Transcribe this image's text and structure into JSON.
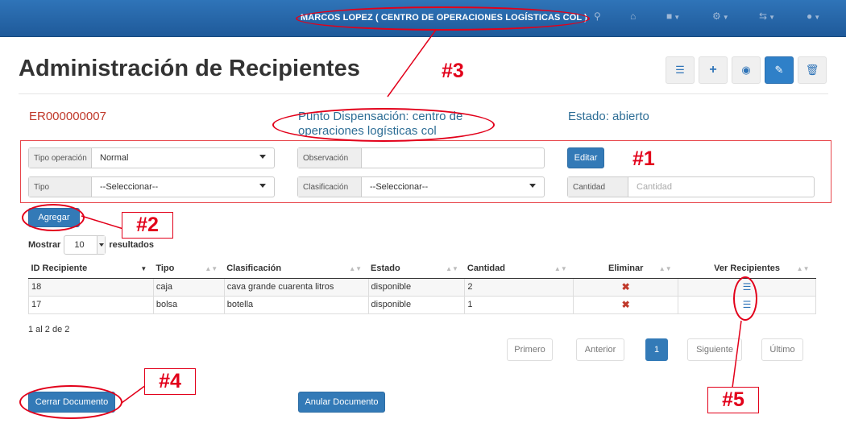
{
  "topbar": {
    "user": "MARCOS LOPEZ ( CENTRO DE OPERACIONES LOGÍSTICAS COL )",
    "icons": [
      "map-marker-icon",
      "home-icon",
      "square-icon",
      "gear-icon",
      "transfer-icon",
      "user-circle-icon"
    ]
  },
  "page": {
    "title": "Administración de Recipientes",
    "toolbar": [
      "list-icon",
      "plus-icon",
      "eye-icon",
      "pencil-icon",
      "trash-icon"
    ]
  },
  "doc": {
    "code": "ER000000007",
    "punto": "Punto Dispensación: centro de operaciones logísticas col",
    "estado": "Estado: abierto"
  },
  "form": {
    "tipo_operacion_label": "Tipo operación",
    "tipo_operacion_value": "Normal",
    "observacion_label": "Observación",
    "observacion_value": "",
    "editar_label": "Editar",
    "tipo_label": "Tipo",
    "tipo_value": "--Seleccionar--",
    "clasificacion_label": "Clasificación",
    "clasificacion_value": "--Seleccionar--",
    "cantidad_label": "Cantidad",
    "cantidad_placeholder": "Cantidad"
  },
  "agregar_label": "Agregar",
  "mostrar": {
    "prefix": "Mostrar",
    "value": "10",
    "suffix": "resultados"
  },
  "table": {
    "headers": [
      "ID Recipiente",
      "Tipo",
      "Clasificación",
      "Estado",
      "Cantidad",
      "Eliminar",
      "Ver Recipientes"
    ],
    "rows": [
      {
        "id": "18",
        "tipo": "caja",
        "clasificacion": "cava grande cuarenta litros",
        "estado": "disponible",
        "cantidad": "2"
      },
      {
        "id": "17",
        "tipo": "bolsa",
        "clasificacion": "botella",
        "estado": "disponible",
        "cantidad": "1"
      }
    ]
  },
  "info": "1 al 2 de 2",
  "pagination": {
    "first": "Primero",
    "prev": "Anterior",
    "current": "1",
    "next": "Siguiente",
    "last": "Último"
  },
  "actions": {
    "cerrar": "Cerrar Documento",
    "anular": "Anular Documento"
  },
  "annotations": {
    "a1": "#1",
    "a2": "#2",
    "a3": "#3",
    "a4": "#4",
    "a5": "#5"
  },
  "colors": {
    "topbar": "#1f5a9a",
    "primary": "#337ab7",
    "annotation": "#e2001a",
    "doc_code": "#c0392b",
    "info_text": "#2e6e96"
  }
}
